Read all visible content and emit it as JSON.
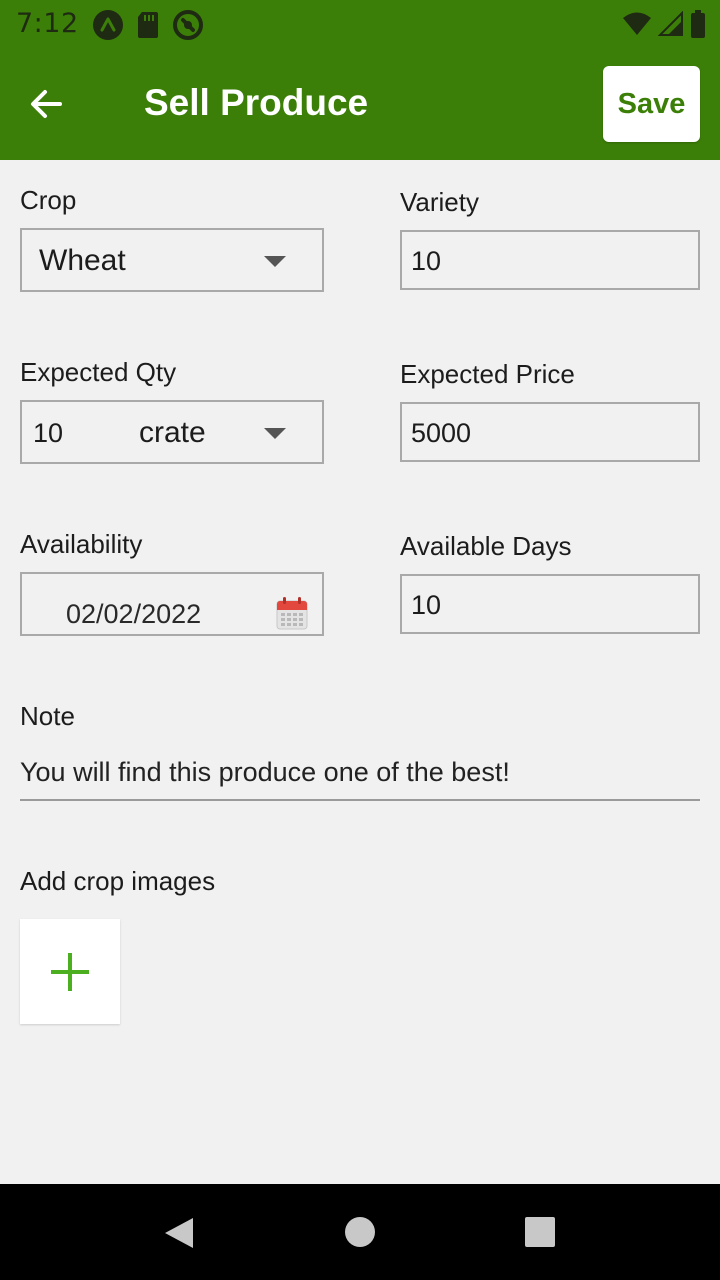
{
  "status_bar": {
    "time": "7:12",
    "left_icons": [
      "app-notification-icon",
      "sd-card-icon",
      "sync-icon"
    ],
    "right_icons": [
      "wifi-icon",
      "cell-signal-icon",
      "battery-icon"
    ]
  },
  "app_bar": {
    "title": "Sell Produce",
    "save_label": "Save",
    "back_icon": "arrow-back-icon",
    "background_color": "#3c7f08"
  },
  "form": {
    "crop": {
      "label": "Crop",
      "value": "Wheat"
    },
    "variety": {
      "label": "Variety",
      "value": "10"
    },
    "expected_qty": {
      "label": "Expected Qty",
      "value": "10",
      "unit": "crate"
    },
    "expected_price": {
      "label": "Expected Price",
      "value": "5000"
    },
    "availability": {
      "label": "Availability",
      "value": "02/02/2022",
      "icon": "calendar-icon"
    },
    "available_days": {
      "label": "Available Days",
      "value": "10"
    },
    "note": {
      "label": "Note",
      "value": "You will find this produce one of the best!"
    },
    "images": {
      "label": "Add crop images",
      "add_icon": "plus-icon",
      "accent_color": "#4caf1f"
    }
  },
  "nav_bar": {
    "buttons": [
      "back-triangle-icon",
      "home-circle-icon",
      "recents-square-icon"
    ]
  }
}
